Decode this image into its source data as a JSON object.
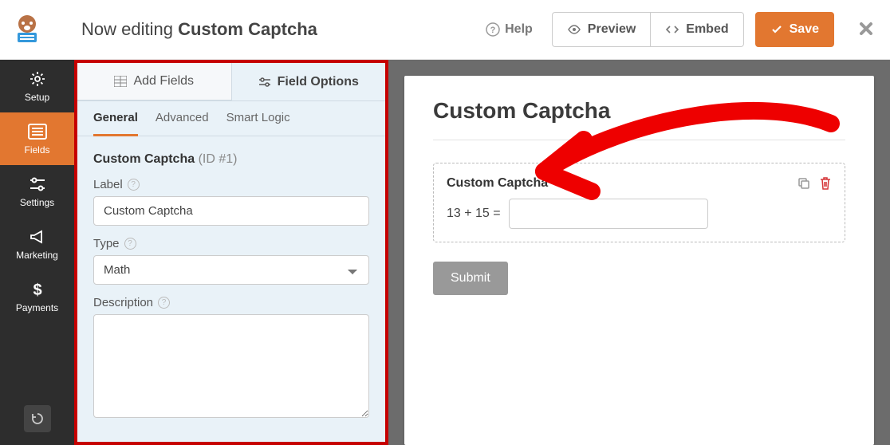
{
  "topbar": {
    "title_prefix": "Now editing ",
    "title_form": "Custom Captcha",
    "help": "Help",
    "preview": "Preview",
    "embed": "Embed",
    "save": "Save"
  },
  "leftnav": {
    "setup": "Setup",
    "fields": "Fields",
    "settings": "Settings",
    "marketing": "Marketing",
    "payments": "Payments"
  },
  "panel": {
    "tab_add_fields": "Add Fields",
    "tab_field_options": "Field Options",
    "sub_general": "General",
    "sub_advanced": "Advanced",
    "sub_smart_logic": "Smart Logic",
    "section_title": "Custom Captcha",
    "section_id": "(ID #1)",
    "label_label": "Label",
    "label_value": "Custom Captcha",
    "type_label": "Type",
    "type_value": "Math",
    "desc_label": "Description",
    "desc_value": ""
  },
  "preview": {
    "form_title": "Custom Captcha",
    "field_label": "Custom Captcha",
    "required_mark": "*",
    "equation": "13 + 15 =",
    "submit": "Submit"
  }
}
